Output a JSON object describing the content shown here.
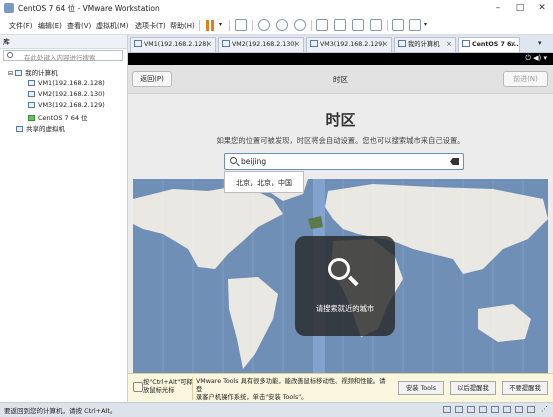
{
  "window": {
    "title": "CentOS 7 64 位 - VMware Workstation"
  },
  "menu": [
    "文件(F)",
    "编辑(E)",
    "查看(V)",
    "虚拟机(M)",
    "选项卡(T)",
    "帮助(H)"
  ],
  "library": {
    "header": "库",
    "search_placeholder": "在此处键入内容进行搜索",
    "root": "我的计算机",
    "vms": [
      "VM1(192.168.2.128)",
      "VM2(192.168.2.130)",
      "VM3(192.168.2.129)",
      "CentOS 7 64 位"
    ],
    "shared": "共享的虚拟机"
  },
  "tabs": [
    "VM1(192.168.2.128)",
    "VM2(192.168.2.130)",
    "VM3(192.168.2.129)",
    "我的计算机",
    "CentOS 7 6..."
  ],
  "installer": {
    "back": "返回(P)",
    "header_title": "时区",
    "next": "前进(N)",
    "title": "时区",
    "subtitle": "如果您的位置可被发现，时区将会自动设置。您也可以搜索城市来自己设置。",
    "search_value": "beijing",
    "suggestion": "北京，北京，中国",
    "overlay_text": "请搜索就近的城市",
    "sys_icons": "⏻ ◀) ▾"
  },
  "hint": {
    "ctrl_line1": "按\"Ctrl+Alt\"可释",
    "ctrl_line2": "放鼠标光标",
    "msg_line1": "VMware Tools 具有很多功能，能改善鼠标移动性、视频和性能。请登",
    "msg_line2": "录客户机操作系统，单击\"安装 Tools\"。",
    "install": "安装 Tools",
    "later": "以后提醒我",
    "never": "不要提醒我"
  },
  "status": "要返回到您的计算机，请按 Ctrl+Alt。",
  "colors": {
    "ocean": "#6f8fb7",
    "land": "#eae8e2",
    "zone_highlight": "#8aa8d6",
    "accent": "#6a8fc4"
  }
}
